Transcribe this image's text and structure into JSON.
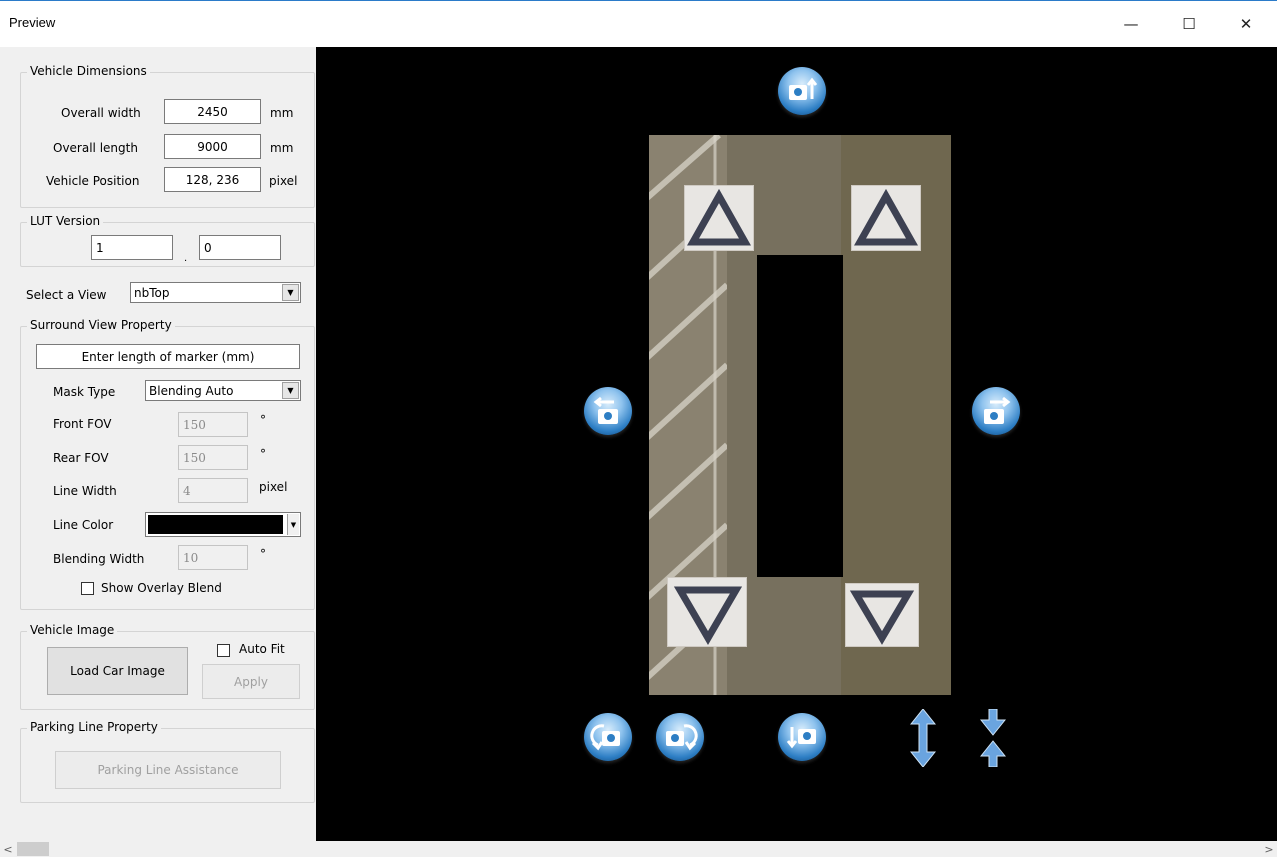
{
  "window": {
    "title": "Preview",
    "minimize_glyph": "—",
    "maximize_glyph": "☐",
    "close_glyph": "✕"
  },
  "vehicle_dimensions": {
    "legend": "Vehicle Dimensions",
    "width_label": "Overall width",
    "width_value": "2450",
    "width_unit": "mm",
    "length_label": "Overall length",
    "length_value": "9000",
    "length_unit": "mm",
    "position_label": "Vehicle Position",
    "position_value": "128, 236",
    "position_unit": "pixel"
  },
  "lut_version": {
    "legend": "LUT Version",
    "major": "1",
    "minor": "0",
    "separator": "."
  },
  "select_view": {
    "label": "Select a View",
    "value": "nbTop"
  },
  "surround_view": {
    "legend": "Surround View Property",
    "marker_length_placeholder": "Enter length of marker (mm)",
    "mask_type_label": "Mask Type",
    "mask_type_value": "Blending Auto",
    "front_fov_label": "Front FOV",
    "front_fov_value": "150",
    "front_fov_unit": "°",
    "rear_fov_label": "Rear FOV",
    "rear_fov_value": "150",
    "rear_fov_unit": "°",
    "line_width_label": "Line Width",
    "line_width_value": "4",
    "line_width_unit": "pixel",
    "line_color_label": "Line Color",
    "line_color_value": "#000000",
    "blending_width_label": "Blending Width",
    "blending_width_value": "10",
    "blending_width_unit": "°",
    "show_overlay_label": "Show Overlay Blend",
    "show_overlay_checked": false
  },
  "vehicle_image": {
    "legend": "Vehicle Image",
    "load_button": "Load Car Image",
    "auto_fit_label": "Auto Fit",
    "auto_fit_checked": false,
    "apply_button": "Apply"
  },
  "parking_line": {
    "legend": "Parking Line Property",
    "assist_button": "Parking Line Assistance"
  },
  "viewport": {
    "background": "#000000",
    "icons": [
      "move-up-camera-icon",
      "move-left-camera-icon",
      "move-right-camera-icon",
      "rotate-ccw-camera-icon",
      "rotate-cw-camera-icon",
      "move-down-camera-icon",
      "stretch-vertical-icon",
      "shrink-vertical-icon"
    ]
  },
  "scrollbar": {
    "left_glyph": "<",
    "right_glyph": ">"
  }
}
